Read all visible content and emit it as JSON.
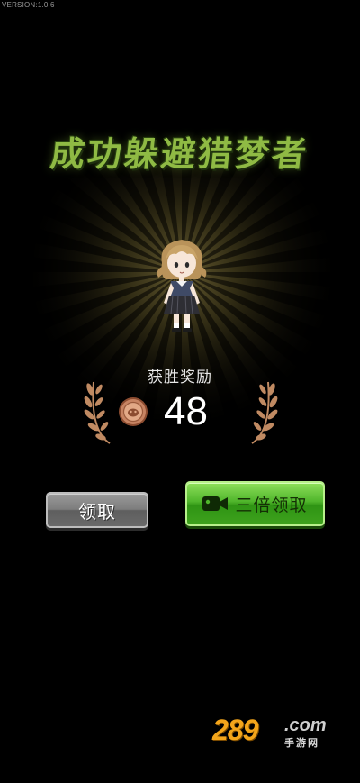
{
  "version": "VERSION:1.0.6",
  "title": "成功躲避猎梦者",
  "reward": {
    "label": "获胜奖励",
    "amount": "48",
    "coin_icon": "bronze-coin-icon"
  },
  "buttons": {
    "claim_label": "领取",
    "triple_claim_label": "三倍领取",
    "triple_icon": "video-camera-icon"
  },
  "watermark": {
    "digits": "289",
    "domain": ".com",
    "sub": "手游网"
  },
  "colors": {
    "title": "#8fba44",
    "claim_button": "#7d7d7d",
    "triple_button": "#4fb52b",
    "ray": "#8a7a3a",
    "coin": "#b06a44"
  }
}
